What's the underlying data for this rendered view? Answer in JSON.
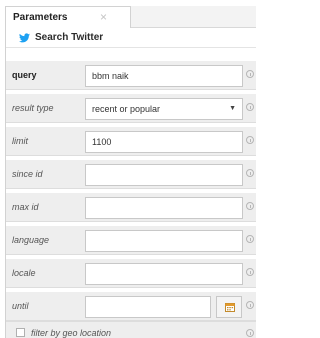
{
  "tab": {
    "label": "Parameters",
    "close_glyph": "×"
  },
  "header": {
    "icon": "twitter-bird-icon",
    "title": "Search Twitter"
  },
  "fields": [
    {
      "label": "query",
      "value": "bbm naik",
      "style": "bold"
    },
    {
      "label": "result type",
      "value": "recent or popular",
      "style": "italic",
      "control": "select"
    },
    {
      "label": "limit",
      "value": "1100",
      "style": "italic"
    },
    {
      "label": "since id",
      "value": "",
      "style": "italic"
    },
    {
      "label": "max id",
      "value": "",
      "style": "italic"
    },
    {
      "label": "language",
      "value": "",
      "style": "italic"
    },
    {
      "label": "locale",
      "value": "",
      "style": "italic"
    },
    {
      "label": "until",
      "value": "",
      "style": "italic",
      "control": "date"
    }
  ],
  "geo_filter": {
    "label": "filter by geo location",
    "checked": false
  },
  "colors": {
    "twitter_blue": "#1da1f2",
    "row_background": "#eeeeee",
    "tab_strip": "#f3f3f3"
  }
}
